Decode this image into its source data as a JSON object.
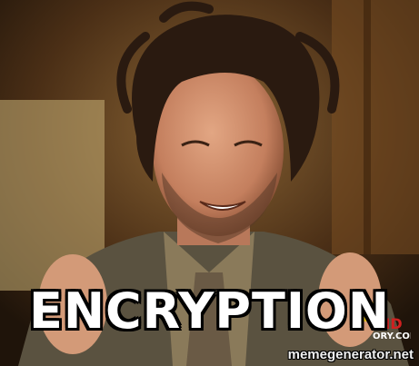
{
  "meme": {
    "caption": "ENCRYPTION",
    "watermark": "memegenerator.net",
    "channel_logo_text": "HD ORY.COM"
  },
  "colors": {
    "caption_fill": "#ffffff",
    "caption_outline": "#000000",
    "background_wood": "#6b4a28",
    "logo_yellow": "#e8c020",
    "logo_red": "#d02020"
  }
}
